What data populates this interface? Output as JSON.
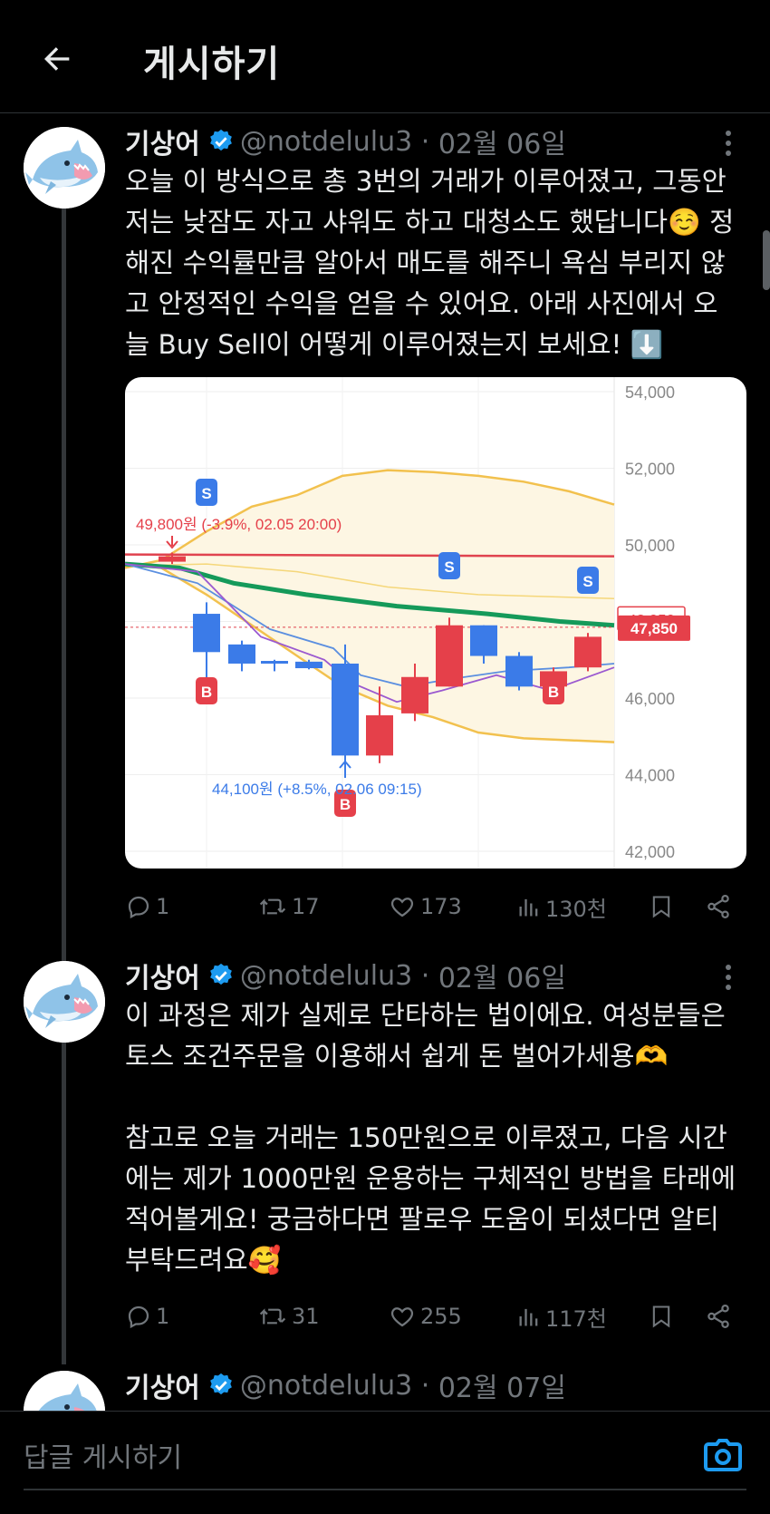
{
  "header": {
    "title": "게시하기",
    "back_icon": "arrow-left-icon"
  },
  "tweets": [
    {
      "name": "기상어",
      "handle": "@notdelulu3",
      "date_sep": " · ",
      "date": "02월 06일",
      "text": "오늘 이 방식으로 총 3번의 거래가 이루어졌고, 그동안 저는 낮잠도 자고 샤워도 하고 대청소도 했답니다☺️ 정해진 수익률만큼 알아서 매도를 해주니 욕심 부리지 않고 안정적인 수익을 얻을 수 있어요. 아래 사진에서 오늘 Buy Sell이 어떻게 이루어졌는지 보세요! ⬇️",
      "stats": {
        "replies": "1",
        "retweets": "17",
        "likes": "173",
        "views": "130천"
      }
    },
    {
      "name": "기상어",
      "handle": "@notdelulu3",
      "date_sep": " · ",
      "date": "02월 06일",
      "text": "이 과정은 제가 실제로 단타하는 법이에요. 여성분들은 토스 조건주문을 이용해서 쉽게 돈 벌어가세용🫶\n\n참고로 오늘 거래는 150만원으로 이루졌고, 다음 시간에는 제가 1000만원 운용하는 구체적인 방법을 타래에 적어볼게요! 궁금하다면 팔로우 도움이 되셨다면 알티 부탁드려요🥰",
      "stats": {
        "replies": "1",
        "retweets": "31",
        "likes": "255",
        "views": "117천"
      }
    },
    {
      "name": "기상어",
      "handle": "@notdelulu3",
      "date_sep": " · ",
      "date": "02월 07일"
    }
  ],
  "chart_data": {
    "type": "candlestick",
    "ylim": [
      42000,
      54000
    ],
    "y_ticks": [
      "54,000",
      "52,000",
      "50,000",
      "48,000",
      "46,000",
      "44,000",
      "42,000"
    ],
    "price_tags": {
      "upper": "48,050",
      "current": "47,850"
    },
    "annotations": {
      "top": "49,800원 (-3.9%, 02.05 20:00)",
      "bottom": "44,100원 (+8.5%, 02.06 09:15)"
    },
    "markers": {
      "buy": "B",
      "sell": "S"
    },
    "candles": [
      {
        "open": 49560,
        "close": 49700,
        "high": 49800,
        "low": 49500,
        "color": "red"
      },
      {
        "open": 48200,
        "close": 47200,
        "high": 48500,
        "low": 46100,
        "color": "blue"
      },
      {
        "open": 47400,
        "close": 46900,
        "high": 47500,
        "low": 46700,
        "color": "blue"
      },
      {
        "open": 46970,
        "close": 46930,
        "high": 47000,
        "low": 46700,
        "color": "blue"
      },
      {
        "open": 46950,
        "close": 46780,
        "high": 47000,
        "low": 46750,
        "color": "blue"
      },
      {
        "open": 46900,
        "close": 44500,
        "high": 47400,
        "low": 44100,
        "color": "blue"
      },
      {
        "open": 44500,
        "close": 45550,
        "high": 46300,
        "low": 44300,
        "color": "red"
      },
      {
        "open": 45600,
        "close": 46550,
        "high": 46900,
        "low": 45400,
        "color": "red"
      },
      {
        "open": 46300,
        "close": 47900,
        "high": 48100,
        "low": 46300,
        "color": "red"
      },
      {
        "open": 47900,
        "close": 47100,
        "high": 47900,
        "low": 46900,
        "color": "blue"
      },
      {
        "open": 47100,
        "close": 46300,
        "high": 47200,
        "low": 46200,
        "color": "blue"
      },
      {
        "open": 46300,
        "close": 46700,
        "high": 46800,
        "low": 46100,
        "color": "red"
      },
      {
        "open": 46800,
        "close": 47600,
        "high": 47700,
        "low": 46700,
        "color": "red"
      }
    ]
  },
  "composer": {
    "placeholder": "답글 게시하기",
    "camera_icon": "camera-icon"
  }
}
